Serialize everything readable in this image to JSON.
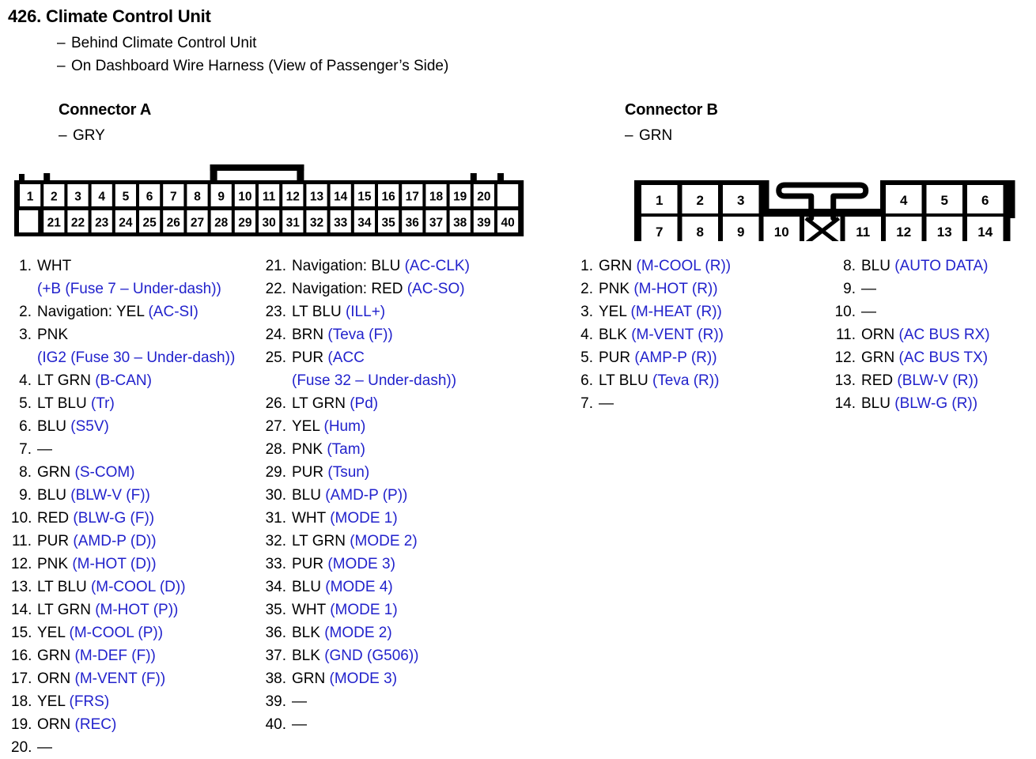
{
  "header": {
    "number": "426.",
    "title": "Climate Control Unit",
    "dash": "–",
    "sub1": "Behind Climate Control Unit",
    "sub2": "On Dashboard Wire Harness (View of Passenger’s Side)"
  },
  "connector_a": {
    "heading": "Connector A",
    "color_label": "GRY",
    "diagram": {
      "row1": [
        "1",
        "2",
        "3",
        "4",
        "5",
        "6",
        "7",
        "8",
        "9",
        "10",
        "11",
        "12",
        "13",
        "14",
        "15",
        "16",
        "17",
        "18",
        "19",
        "20"
      ],
      "row2": [
        "21",
        "22",
        "23",
        "24",
        "25",
        "26",
        "27",
        "28",
        "29",
        "30",
        "31",
        "32",
        "33",
        "34",
        "35",
        "36",
        "37",
        "38",
        "39",
        "40"
      ]
    },
    "pins": [
      {
        "n": "1.",
        "wire": "WHT",
        "sig": "",
        "wrap": "(+B (Fuse 7 – Under-dash))"
      },
      {
        "n": "2.",
        "wire": "Navigation: YEL",
        "sig": "(AC-SI)"
      },
      {
        "n": "3.",
        "wire": "PNK",
        "sig": "",
        "wrap": "(IG2 (Fuse 30 – Under-dash))"
      },
      {
        "n": "4.",
        "wire": "LT GRN",
        "sig": "(B-CAN)"
      },
      {
        "n": "5.",
        "wire": "LT BLU",
        "sig": "(Tr)"
      },
      {
        "n": "6.",
        "wire": "BLU",
        "sig": "(S5V)"
      },
      {
        "n": "7.",
        "wire": "—",
        "sig": ""
      },
      {
        "n": "8.",
        "wire": "GRN",
        "sig": "(S-COM)"
      },
      {
        "n": "9.",
        "wire": "BLU",
        "sig": "(BLW-V (F))"
      },
      {
        "n": "10.",
        "wire": "RED",
        "sig": "(BLW-G (F))"
      },
      {
        "n": "11.",
        "wire": "PUR",
        "sig": "(AMD-P (D))"
      },
      {
        "n": "12.",
        "wire": "PNK",
        "sig": "(M-HOT (D))"
      },
      {
        "n": "13.",
        "wire": "LT BLU",
        "sig": "(M-COOL (D))"
      },
      {
        "n": "14.",
        "wire": "LT GRN",
        "sig": "(M-HOT (P))"
      },
      {
        "n": "15.",
        "wire": "YEL",
        "sig": "(M-COOL (P))"
      },
      {
        "n": "16.",
        "wire": "GRN",
        "sig": "(M-DEF (F))"
      },
      {
        "n": "17.",
        "wire": "ORN",
        "sig": "(M-VENT (F))"
      },
      {
        "n": "18.",
        "wire": "YEL",
        "sig": "(FRS)"
      },
      {
        "n": "19.",
        "wire": "ORN",
        "sig": "(REC)"
      },
      {
        "n": "20.",
        "wire": "—",
        "sig": ""
      }
    ],
    "pins2": [
      {
        "n": "21.",
        "wire": "Navigation: BLU",
        "sig": "(AC-CLK)"
      },
      {
        "n": "22.",
        "wire": "Navigation: RED",
        "sig": "(AC-SO)"
      },
      {
        "n": "23.",
        "wire": "LT BLU",
        "sig": "(ILL+)"
      },
      {
        "n": "24.",
        "wire": "BRN",
        "sig": "(Teva (F))"
      },
      {
        "n": "25.",
        "wire": "PUR",
        "sig": "(ACC",
        "wrap": "(Fuse 32 – Under-dash))"
      },
      {
        "n": "26.",
        "wire": "LT GRN",
        "sig": "(Pd)"
      },
      {
        "n": "27.",
        "wire": "YEL",
        "sig": "(Hum)"
      },
      {
        "n": "28.",
        "wire": "PNK",
        "sig": "(Tam)"
      },
      {
        "n": "29.",
        "wire": "PUR",
        "sig": "(Tsun)"
      },
      {
        "n": "30.",
        "wire": "BLU",
        "sig": "(AMD-P (P))"
      },
      {
        "n": "31.",
        "wire": "WHT",
        "sig": "(MODE 1)"
      },
      {
        "n": "32.",
        "wire": "LT GRN",
        "sig": "(MODE 2)"
      },
      {
        "n": "33.",
        "wire": "PUR",
        "sig": "(MODE 3)"
      },
      {
        "n": "34.",
        "wire": "BLU",
        "sig": "(MODE 4)"
      },
      {
        "n": "35.",
        "wire": "WHT",
        "sig": "(MODE 1)"
      },
      {
        "n": "36.",
        "wire": "BLK",
        "sig": "(MODE 2)"
      },
      {
        "n": "37.",
        "wire": "BLK",
        "sig": "(GND (G506))"
      },
      {
        "n": "38.",
        "wire": "GRN",
        "sig": "(MODE 3)"
      },
      {
        "n": "39.",
        "wire": "—",
        "sig": ""
      },
      {
        "n": "40.",
        "wire": "—",
        "sig": ""
      }
    ]
  },
  "connector_b": {
    "heading": "Connector B",
    "color_label": "GRN",
    "diagram": {
      "row1": [
        "1",
        "2",
        "3",
        "",
        "",
        "4",
        "5",
        "6"
      ],
      "row2": [
        "7",
        "8",
        "9",
        "10",
        "",
        "11",
        "12",
        "13",
        "14"
      ]
    },
    "pins": [
      {
        "n": "1.",
        "wire": "GRN",
        "sig": "(M-COOL (R))"
      },
      {
        "n": "2.",
        "wire": "PNK",
        "sig": "(M-HOT (R))"
      },
      {
        "n": "3.",
        "wire": "YEL",
        "sig": "(M-HEAT (R))"
      },
      {
        "n": "4.",
        "wire": "BLK",
        "sig": "(M-VENT (R))"
      },
      {
        "n": "5.",
        "wire": "PUR",
        "sig": "(AMP-P (R))"
      },
      {
        "n": "6.",
        "wire": "LT BLU",
        "sig": "(Teva (R))"
      },
      {
        "n": "7.",
        "wire": "—",
        "sig": ""
      }
    ],
    "pins2": [
      {
        "n": "8.",
        "wire": "BLU",
        "sig": "(AUTO DATA)"
      },
      {
        "n": "9.",
        "wire": "—",
        "sig": ""
      },
      {
        "n": "10.",
        "wire": "—",
        "sig": ""
      },
      {
        "n": "11.",
        "wire": "ORN",
        "sig": "(AC BUS RX)"
      },
      {
        "n": "12.",
        "wire": "GRN",
        "sig": "(AC BUS TX)"
      },
      {
        "n": "13.",
        "wire": "RED",
        "sig": "(BLW-V (R))"
      },
      {
        "n": "14.",
        "wire": "BLU",
        "sig": "(BLW-G (R))"
      }
    ]
  },
  "colors": {
    "signal_blue": "#2222cc",
    "text_black": "#000000",
    "background": "#ffffff"
  }
}
